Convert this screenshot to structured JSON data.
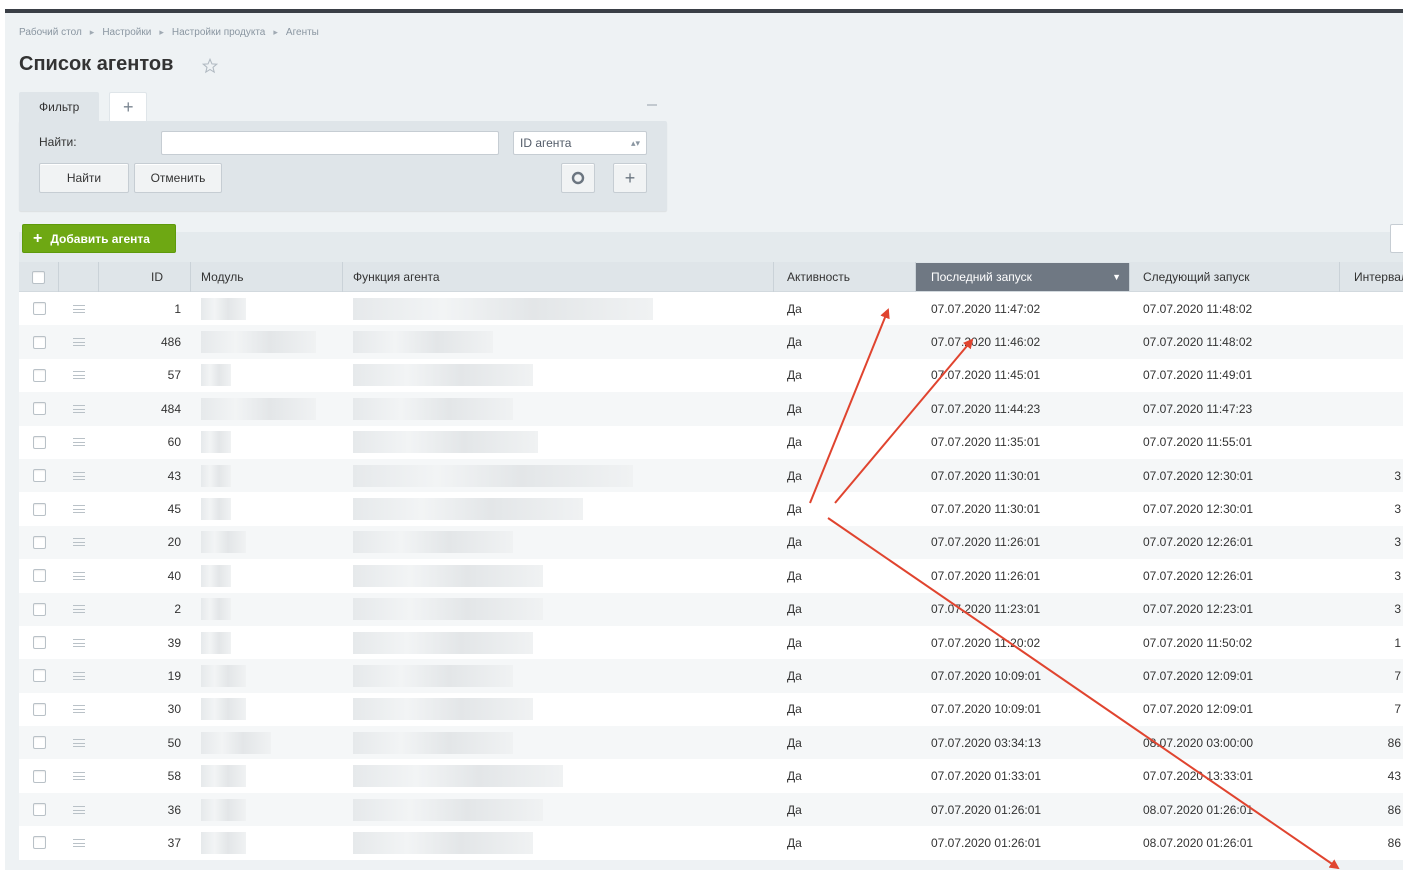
{
  "breadcrumb": [
    "Рабочий стол",
    "Настройки",
    "Настройки продукта",
    "Агенты"
  ],
  "page_title": "Список агентов",
  "filter": {
    "tab_label": "Фильтр",
    "find_label": "Найти:",
    "search_value": "",
    "select_value": "ID агента",
    "find_button": "Найти",
    "cancel_button": "Отменить"
  },
  "toolbar": {
    "add_agent": "Добавить агента"
  },
  "columns": {
    "id": "ID",
    "module": "Модуль",
    "function": "Функция агента",
    "active": "Активность",
    "last_run": "Последний запуск",
    "next_run": "Следующий запуск",
    "interval": "Интервал"
  },
  "rows": [
    {
      "id": "1",
      "active": "Да",
      "last_run": "07.07.2020 11:47:02",
      "next_run": "07.07.2020 11:48:02",
      "interval": ""
    },
    {
      "id": "486",
      "active": "Да",
      "last_run": "07.07.2020 11:46:02",
      "next_run": "07.07.2020 11:48:02",
      "interval": ""
    },
    {
      "id": "57",
      "active": "Да",
      "last_run": "07.07.2020 11:45:01",
      "next_run": "07.07.2020 11:49:01",
      "interval": ""
    },
    {
      "id": "484",
      "active": "Да",
      "last_run": "07.07.2020 11:44:23",
      "next_run": "07.07.2020 11:47:23",
      "interval": ""
    },
    {
      "id": "60",
      "active": "Да",
      "last_run": "07.07.2020 11:35:01",
      "next_run": "07.07.2020 11:55:01",
      "interval": ""
    },
    {
      "id": "43",
      "active": "Да",
      "last_run": "07.07.2020 11:30:01",
      "next_run": "07.07.2020 12:30:01",
      "interval": "3"
    },
    {
      "id": "45",
      "active": "Да",
      "last_run": "07.07.2020 11:30:01",
      "next_run": "07.07.2020 12:30:01",
      "interval": "3"
    },
    {
      "id": "20",
      "active": "Да",
      "last_run": "07.07.2020 11:26:01",
      "next_run": "07.07.2020 12:26:01",
      "interval": "3"
    },
    {
      "id": "40",
      "active": "Да",
      "last_run": "07.07.2020 11:26:01",
      "next_run": "07.07.2020 12:26:01",
      "interval": "3"
    },
    {
      "id": "2",
      "active": "Да",
      "last_run": "07.07.2020 11:23:01",
      "next_run": "07.07.2020 12:23:01",
      "interval": "3"
    },
    {
      "id": "39",
      "active": "Да",
      "last_run": "07.07.2020 11:20:02",
      "next_run": "07.07.2020 11:50:02",
      "interval": "1"
    },
    {
      "id": "19",
      "active": "Да",
      "last_run": "07.07.2020 10:09:01",
      "next_run": "07.07.2020 12:09:01",
      "interval": "7"
    },
    {
      "id": "30",
      "active": "Да",
      "last_run": "07.07.2020 10:09:01",
      "next_run": "07.07.2020 12:09:01",
      "interval": "7"
    },
    {
      "id": "50",
      "active": "Да",
      "last_run": "07.07.2020 03:34:13",
      "next_run": "08.07.2020 03:00:00",
      "interval": "86"
    },
    {
      "id": "58",
      "active": "Да",
      "last_run": "07.07.2020 01:33:01",
      "next_run": "07.07.2020 13:33:01",
      "interval": "43"
    },
    {
      "id": "36",
      "active": "Да",
      "last_run": "07.07.2020 01:26:01",
      "next_run": "08.07.2020 01:26:01",
      "interval": "86"
    },
    {
      "id": "37",
      "active": "Да",
      "last_run": "07.07.2020 01:26:01",
      "next_run": "08.07.2020 01:26:01",
      "interval": "86"
    }
  ],
  "colors": {
    "accent_green": "#6ea813",
    "sorted_header": "#6f7883",
    "annotation_arrow": "#e0442f"
  }
}
